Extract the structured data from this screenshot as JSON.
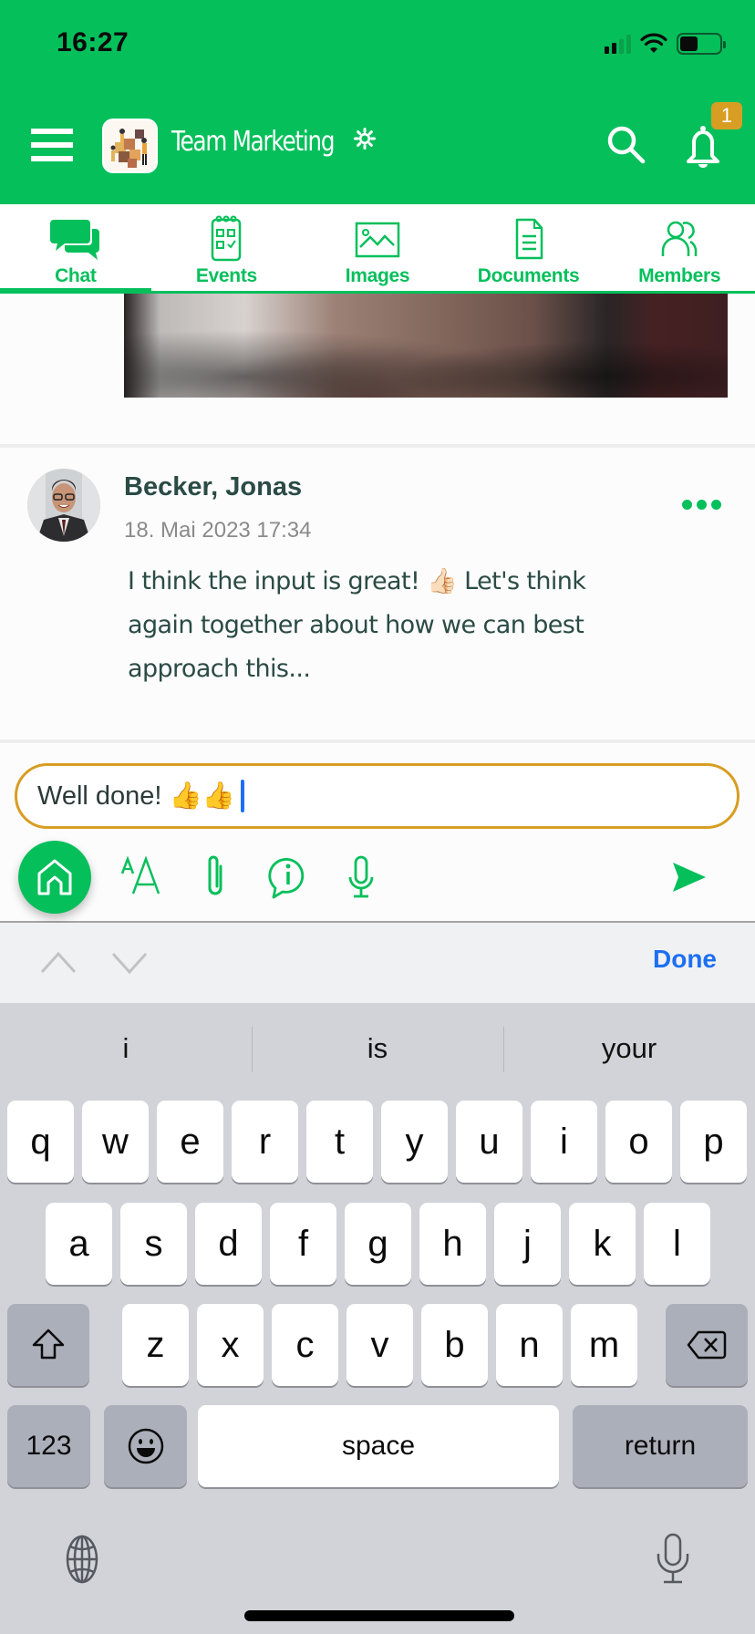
{
  "status_bar": {
    "time": "16:27",
    "battery_level": 0.45,
    "signal_bars": 2
  },
  "header": {
    "menu_icon": "hamburger-icon",
    "group_title": "Team Marketing",
    "settings_icon": "gear-icon",
    "search_icon": "search-icon",
    "notifications_icon": "bell-icon",
    "notification_count": "1"
  },
  "tabs": [
    {
      "label": "Chat",
      "icon": "chat-bubbles-icon",
      "active": true
    },
    {
      "label": "Events",
      "icon": "calendar-icon",
      "active": false
    },
    {
      "label": "Images",
      "icon": "image-icon",
      "active": false
    },
    {
      "label": "Documents",
      "icon": "document-icon",
      "active": false
    },
    {
      "label": "Members",
      "icon": "members-icon",
      "active": false
    }
  ],
  "post": {
    "author": "Becker, Jonas",
    "timestamp": "18. Mai 2023 17:34",
    "body": "I think the input is great! 👍🏻 Let's think again together about how we can best approach this...",
    "more_icon": "more-dots-icon"
  },
  "composer": {
    "input_value": "Well done! 👍👍",
    "tools": [
      "home-icon",
      "text-format-icon",
      "paperclip-icon",
      "info-bubble-icon",
      "microphone-icon"
    ],
    "send_icon": "send-icon"
  },
  "keyboard_accessory": {
    "prev_icon": "chevron-up-icon",
    "next_icon": "chevron-down-icon",
    "done_label": "Done"
  },
  "keyboard": {
    "suggestions": [
      "i",
      "is",
      "your"
    ],
    "row1": [
      "q",
      "w",
      "e",
      "r",
      "t",
      "y",
      "u",
      "i",
      "o",
      "p"
    ],
    "row2": [
      "a",
      "s",
      "d",
      "f",
      "g",
      "h",
      "j",
      "k",
      "l"
    ],
    "row3": [
      "z",
      "x",
      "c",
      "v",
      "b",
      "n",
      "m"
    ],
    "numbers_label": "123",
    "space_label": "space",
    "return_label": "return",
    "globe_icon": "globe-icon",
    "dictation_icon": "microphone-icon"
  },
  "colors": {
    "brand_green": "#05bf5b",
    "badge_orange": "#d89d23",
    "input_border": "#d89d23",
    "link_blue": "#1d6ff2",
    "text_dark_green": "#2b4b45"
  }
}
